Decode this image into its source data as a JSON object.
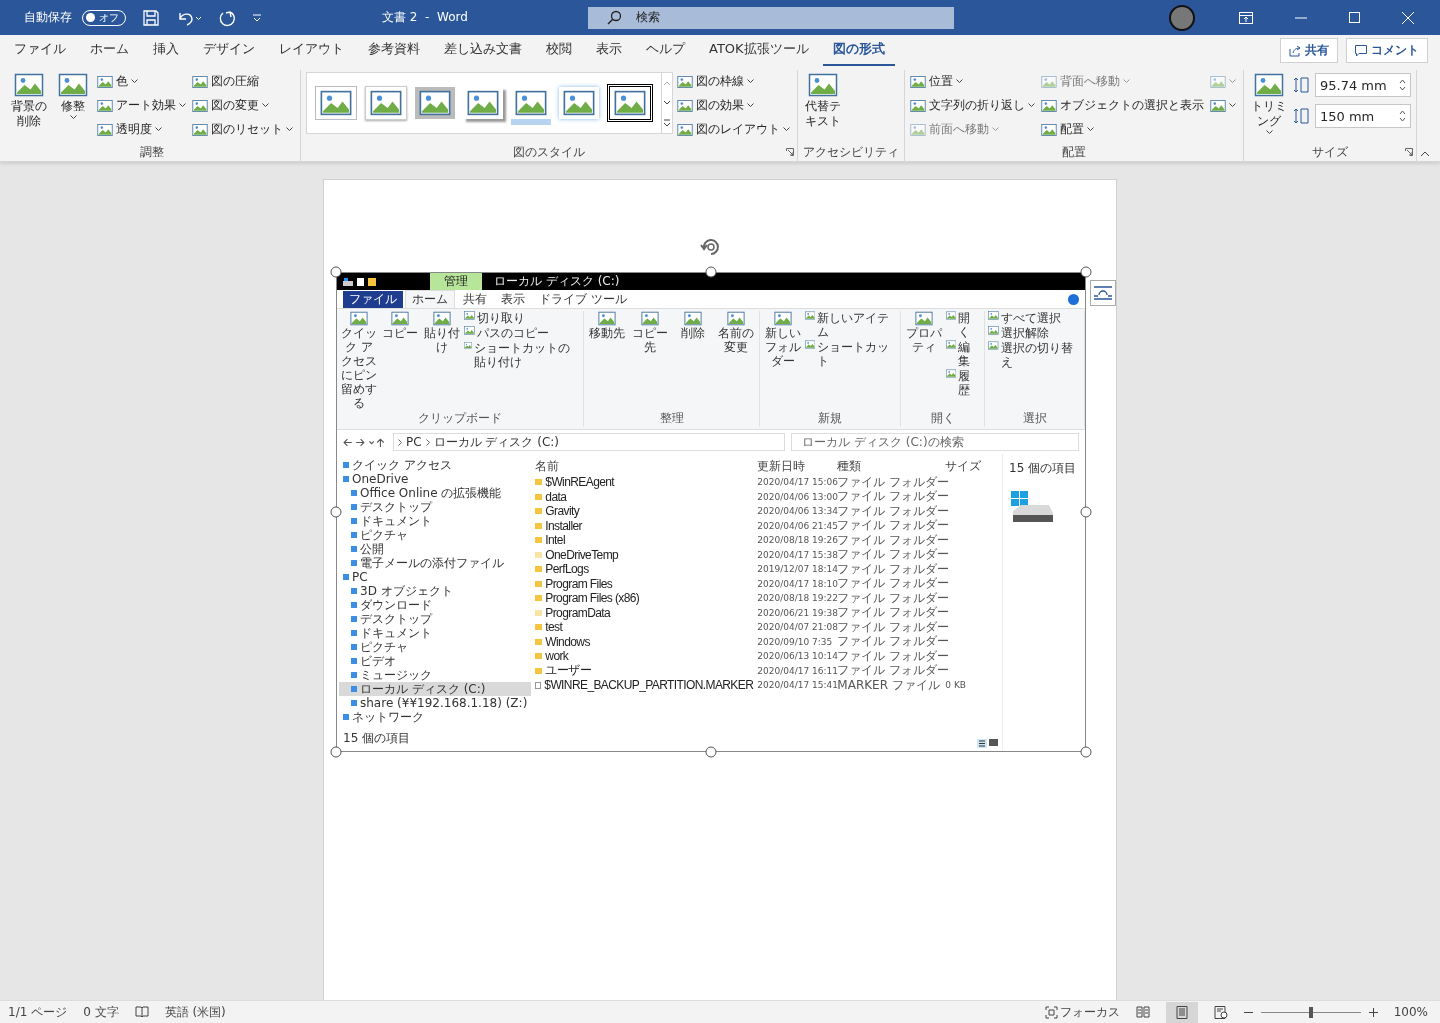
{
  "titlebar": {
    "autosave_label": "自動保存",
    "autosave_toggle": {
      "label": "オフ",
      "on": false
    },
    "title": "文書 2  -  Word",
    "search": {
      "placeholder": "検索"
    }
  },
  "tabs": [
    {
      "label": "ファイル",
      "selected": false
    },
    {
      "label": "ホーム",
      "selected": false
    },
    {
      "label": "挿入",
      "selected": false
    },
    {
      "label": "デザイン",
      "selected": false
    },
    {
      "label": "レイアウト",
      "selected": false
    },
    {
      "label": "参考資料",
      "selected": false
    },
    {
      "label": "差し込み文書",
      "selected": false
    },
    {
      "label": "校閲",
      "selected": false
    },
    {
      "label": "表示",
      "selected": false
    },
    {
      "label": "ヘルプ",
      "selected": false
    },
    {
      "label": "ATOK拡張ツール",
      "selected": false
    },
    {
      "label": "図の形式",
      "selected": true
    }
  ],
  "share_button": "共有",
  "comment_button": "コメント",
  "ribbon": [
    {
      "label": "調整",
      "launcher": false,
      "items": [
        {
          "kind": "large",
          "label": "背景の削除",
          "caret": false,
          "disabled": false
        },
        {
          "kind": "large",
          "label": "修整",
          "caret": true,
          "disabled": false
        },
        {
          "kind": "small",
          "label": "色",
          "caret": true,
          "disabled": false
        },
        {
          "kind": "small",
          "label": "アート効果",
          "caret": true,
          "disabled": false
        },
        {
          "kind": "small",
          "label": "透明度",
          "caret": true,
          "disabled": false
        },
        {
          "kind": "small",
          "label": "図の圧縮",
          "caret": false,
          "disabled": false
        },
        {
          "kind": "small",
          "label": "図の変更",
          "caret": true,
          "disabled": false
        },
        {
          "kind": "small",
          "label": "図のリセット",
          "caret": true,
          "disabled": false
        }
      ]
    },
    {
      "label": "図のスタイル",
      "launcher": true,
      "thumbnails": [
        {
          "kind": "thin"
        },
        {
          "kind": "white"
        },
        {
          "kind": "grey"
        },
        {
          "kind": "shadow"
        },
        {
          "kind": "reflect"
        },
        {
          "kind": "soft"
        },
        {
          "kind": "black"
        }
      ],
      "items": [
        {
          "kind": "small",
          "label": "図の枠線",
          "caret": true,
          "disabled": false
        },
        {
          "kind": "small",
          "label": "図の効果",
          "caret": true,
          "disabled": false
        },
        {
          "kind": "small",
          "label": "図のレイアウト",
          "caret": true,
          "disabled": false
        }
      ]
    },
    {
      "label": "アクセシビリティ",
      "launcher": false,
      "items": [
        {
          "kind": "large",
          "label": "代替テキスト",
          "caret": false,
          "disabled": false
        }
      ]
    },
    {
      "label": "配置",
      "launcher": false,
      "items": [
        {
          "kind": "small",
          "label": "位置",
          "caret": true,
          "disabled": false
        },
        {
          "kind": "small",
          "label": "文字列の折り返し",
          "caret": true,
          "disabled": false
        },
        {
          "kind": "small",
          "label": "前面へ移動",
          "caret": true,
          "disabled": true
        },
        {
          "kind": "small",
          "label": "背面へ移動",
          "caret": true,
          "disabled": true
        },
        {
          "kind": "small",
          "label": "オブジェクトの選択と表示",
          "caret": false,
          "disabled": false
        },
        {
          "kind": "small",
          "label": "配置",
          "caret": true,
          "disabled": false
        },
        {
          "kind": "icon",
          "caret": true,
          "disabled": true
        },
        {
          "kind": "icon",
          "caret": true,
          "disabled": false
        }
      ]
    },
    {
      "label": "サイズ",
      "launcher": true,
      "items": [
        {
          "kind": "large",
          "label": "トリミング",
          "caret": true,
          "disabled": false
        },
        {
          "kind": "field",
          "value": "95.74 mm"
        },
        {
          "kind": "field",
          "value": "150 mm"
        }
      ]
    }
  ],
  "explorer": {
    "title": "ローカル ディスク (C:)",
    "context_tab": "管理",
    "tabs": [
      {
        "label": "ファイル",
        "selected": false,
        "kind": "file"
      },
      {
        "label": "ホーム",
        "selected": true,
        "kind": "tab"
      },
      {
        "label": "共有",
        "selected": false,
        "kind": "tab"
      },
      {
        "label": "表示",
        "selected": false,
        "kind": "tab"
      },
      {
        "label": "ドライブ ツール",
        "selected": false,
        "kind": "tab"
      }
    ],
    "ribbon": [
      {
        "label": "クリップボード",
        "items": [
          {
            "kind": "large",
            "label": "クイック アクセスにピン留めする"
          },
          {
            "kind": "large",
            "label": "コピー"
          },
          {
            "kind": "large",
            "label": "貼り付け"
          },
          {
            "kind": "small",
            "label": "切り取り"
          },
          {
            "kind": "small",
            "label": "パスのコピー"
          },
          {
            "kind": "small",
            "label": "ショートカットの貼り付け"
          }
        ]
      },
      {
        "label": "整理",
        "items": [
          {
            "kind": "large",
            "label": "移動先"
          },
          {
            "kind": "large",
            "label": "コピー先"
          },
          {
            "kind": "large",
            "label": "削除"
          },
          {
            "kind": "large",
            "label": "名前の変更"
          }
        ]
      },
      {
        "label": "新規",
        "items": [
          {
            "kind": "large",
            "label": "新しいフォルダー"
          },
          {
            "kind": "small",
            "label": "新しいアイテム"
          },
          {
            "kind": "small",
            "label": "ショートカット"
          }
        ]
      },
      {
        "label": "開く",
        "items": [
          {
            "kind": "large",
            "label": "プロパティ"
          },
          {
            "kind": "small",
            "label": "開く"
          },
          {
            "kind": "small",
            "label": "編集"
          },
          {
            "kind": "small",
            "label": "履歴"
          }
        ]
      },
      {
        "label": "選択",
        "items": [
          {
            "kind": "small",
            "label": "すべて選択"
          },
          {
            "kind": "small",
            "label": "選択解除"
          },
          {
            "kind": "small",
            "label": "選択の切り替え"
          }
        ]
      }
    ],
    "address": [
      "PC",
      "ローカル ディスク (C:)"
    ],
    "search": {
      "placeholder": "ローカル ディスク (C:)の検索"
    },
    "nav": [
      {
        "label": "クイック アクセス",
        "selected": false
      },
      {
        "label": "OneDrive",
        "selected": false,
        "children": [
          {
            "label": "Office Online の拡張機能",
            "selected": false
          },
          {
            "label": "デスクトップ",
            "selected": false
          },
          {
            "label": "ドキュメント",
            "selected": false
          },
          {
            "label": "ピクチャ",
            "selected": false
          },
          {
            "label": "公開",
            "selected": false
          },
          {
            "label": "電子メールの添付ファイル",
            "selected": false
          }
        ]
      },
      {
        "label": "PC",
        "selected": false,
        "children": [
          {
            "label": "3D オブジェクト",
            "selected": false
          },
          {
            "label": "ダウンロード",
            "selected": false
          },
          {
            "label": "デスクトップ",
            "selected": false
          },
          {
            "label": "ドキュメント",
            "selected": false
          },
          {
            "label": "ピクチャ",
            "selected": false
          },
          {
            "label": "ビデオ",
            "selected": false
          },
          {
            "label": "ミュージック",
            "selected": false
          },
          {
            "label": "ローカル ディスク (C:)",
            "selected": true
          },
          {
            "label": "share (¥¥192.168.1.18) (Z:)",
            "selected": false
          }
        ]
      },
      {
        "label": "ネットワーク",
        "selected": false
      }
    ],
    "columns": [
      "名前",
      "更新日時",
      "種類",
      "サイズ"
    ],
    "rows": [
      {
        "kind": "folder",
        "hidden": false,
        "name": "$WinREAgent",
        "date": "2020/04/17 15:06",
        "type": "ファイル フォルダー"
      },
      {
        "kind": "folder",
        "hidden": false,
        "name": "data",
        "date": "2020/04/06 13:00",
        "type": "ファイル フォルダー"
      },
      {
        "kind": "folder",
        "hidden": false,
        "name": "Gravity",
        "date": "2020/04/06 13:34",
        "type": "ファイル フォルダー"
      },
      {
        "kind": "folder",
        "hidden": false,
        "name": "Installer",
        "date": "2020/04/06 21:45",
        "type": "ファイル フォルダー"
      },
      {
        "kind": "folder",
        "hidden": false,
        "name": "Intel",
        "date": "2020/08/18 19:26",
        "type": "ファイル フォルダー"
      },
      {
        "kind": "folder",
        "hidden": true,
        "name": "OneDriveTemp",
        "date": "2020/04/17 15:38",
        "type": "ファイル フォルダー"
      },
      {
        "kind": "folder",
        "hidden": false,
        "name": "PerfLogs",
        "date": "2019/12/07 18:14",
        "type": "ファイル フォルダー"
      },
      {
        "kind": "folder",
        "hidden": false,
        "name": "Program Files",
        "date": "2020/04/17 18:10",
        "type": "ファイル フォルダー"
      },
      {
        "kind": "folder",
        "hidden": false,
        "name": "Program Files (x86)",
        "date": "2020/08/18 19:22",
        "type": "ファイル フォルダー"
      },
      {
        "kind": "folder",
        "hidden": true,
        "name": "ProgramData",
        "date": "2020/06/21 19:38",
        "type": "ファイル フォルダー"
      },
      {
        "kind": "folder",
        "hidden": false,
        "name": "test",
        "date": "2020/04/07 21:08",
        "type": "ファイル フォルダー"
      },
      {
        "kind": "folder",
        "hidden": false,
        "name": "Windows",
        "date": "2020/09/10 7:35",
        "type": "ファイル フォルダー"
      },
      {
        "kind": "folder",
        "hidden": false,
        "name": "work",
        "date": "2020/06/13 10:14",
        "type": "ファイル フォルダー"
      },
      {
        "kind": "folder",
        "hidden": false,
        "name": "ユーザー",
        "date": "2020/04/17 16:11",
        "type": "ファイル フォルダー"
      },
      {
        "kind": "file",
        "hidden": false,
        "name": "$WINRE_BACKUP_PARTITION.MARKER",
        "date": "2020/04/17 15:41",
        "type": "MARKER ファイル",
        "size": "0 KB"
      }
    ],
    "details_title": "15 個の項目",
    "status": "15 個の項目"
  },
  "statusbar": {
    "page": "1/1 ページ",
    "words": "0 文字",
    "language": "英語 (米国)",
    "focus": "フォーカス",
    "zoom": {
      "level": 0.5
    },
    "zoom_label": "100%"
  }
}
